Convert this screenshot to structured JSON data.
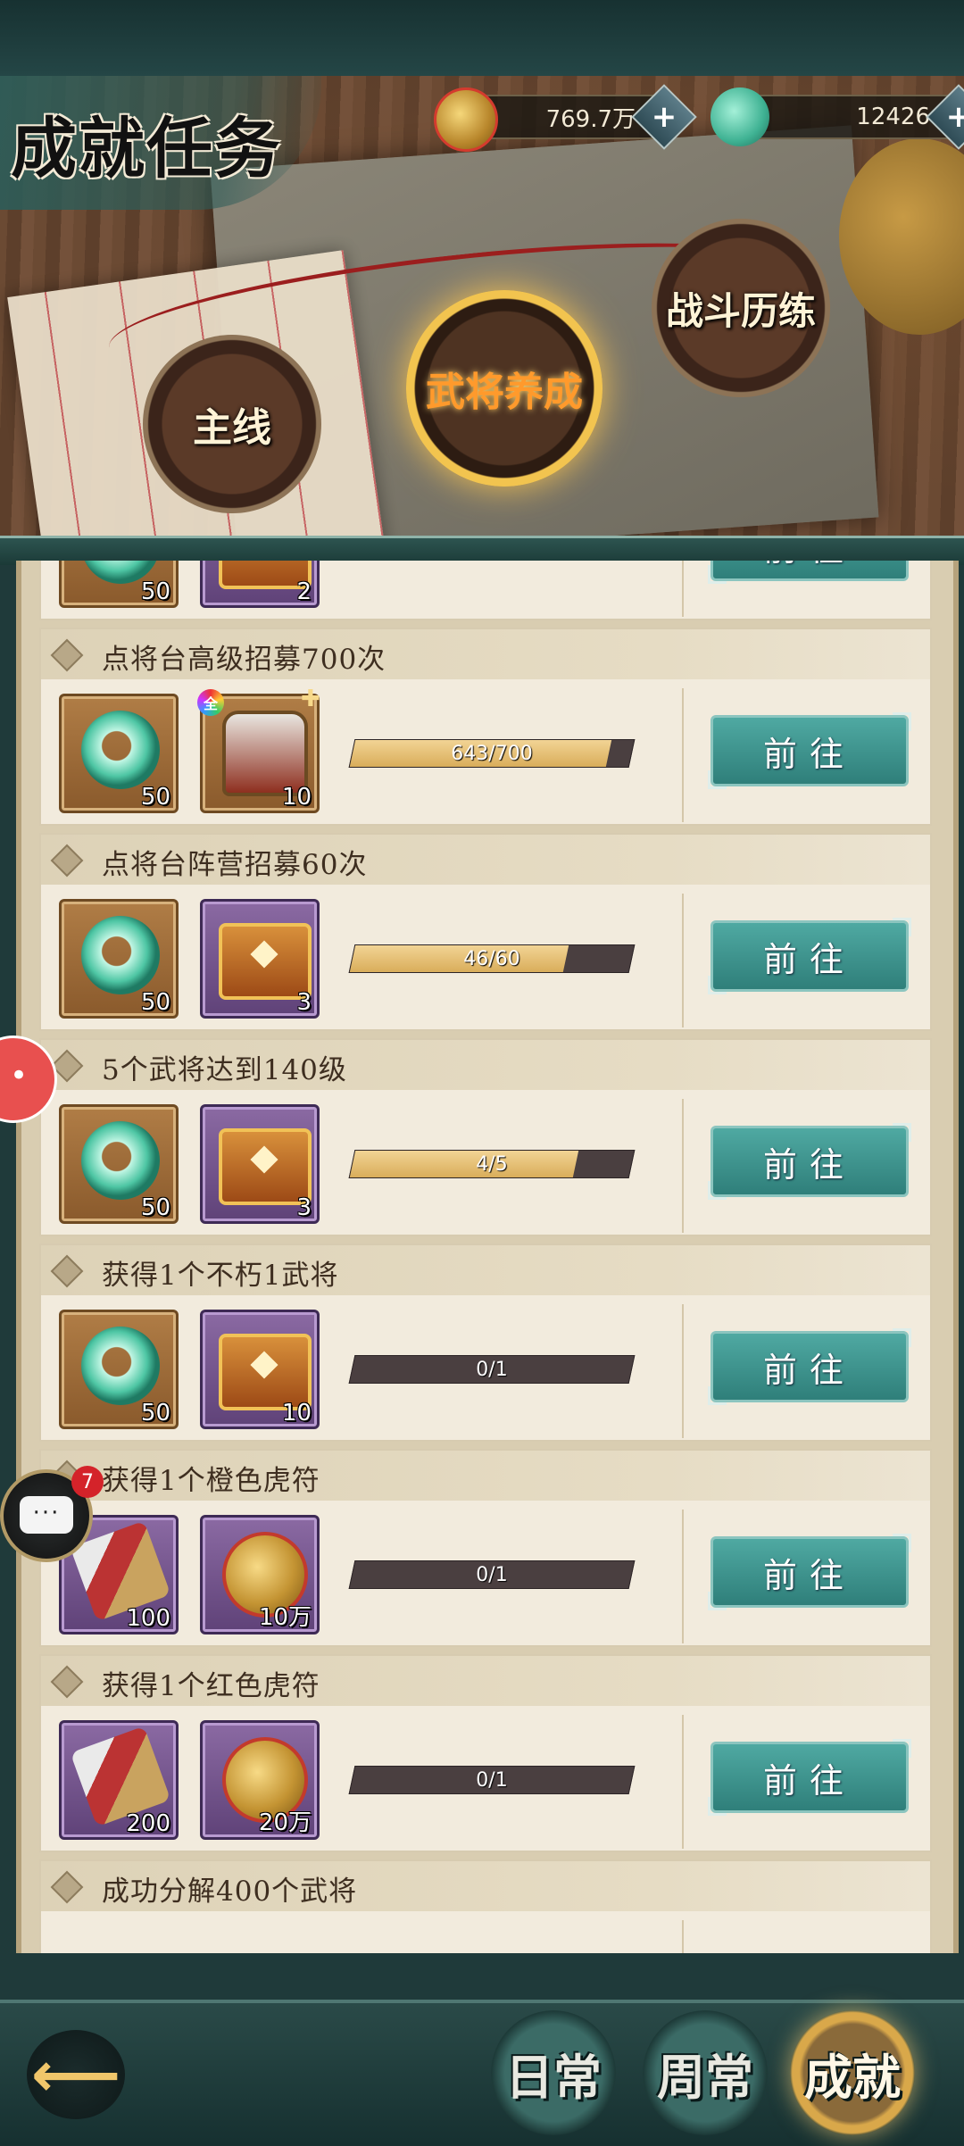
{
  "header": {
    "title": "成就任务",
    "gold_amount": "769.7万",
    "jade_amount": "12426",
    "categories": [
      "主线",
      "武将养成",
      "战斗历练"
    ]
  },
  "tasks": [
    {
      "title": "",
      "rewards": [
        {
          "type": "jade",
          "qty": "50"
        },
        {
          "type": "chest",
          "qty": "2"
        }
      ],
      "progress_text": "",
      "progress": null,
      "button": "前往",
      "partial": true
    },
    {
      "title": "点将台高级招募700次",
      "rewards": [
        {
          "type": "jade",
          "qty": "50"
        },
        {
          "type": "helmet",
          "qty": "10",
          "badge": "全"
        }
      ],
      "progress_text": "643/700",
      "progress": 0.919,
      "button": "前往"
    },
    {
      "title": "点将台阵营招募60次",
      "rewards": [
        {
          "type": "jade",
          "qty": "50"
        },
        {
          "type": "chest",
          "qty": "3"
        }
      ],
      "progress_text": "46/60",
      "progress": 0.767,
      "button": "前往"
    },
    {
      "title": "5个武将达到140级",
      "rewards": [
        {
          "type": "jade",
          "qty": "50"
        },
        {
          "type": "chest",
          "qty": "3"
        }
      ],
      "progress_text": "4/5",
      "progress": 0.8,
      "button": "前往"
    },
    {
      "title": "获得1个不朽1武将",
      "rewards": [
        {
          "type": "jade",
          "qty": "50"
        },
        {
          "type": "chest",
          "qty": "10"
        }
      ],
      "progress_text": "0/1",
      "progress": 0,
      "button": "前往"
    },
    {
      "title": "获得1个橙色虎符",
      "rewards": [
        {
          "type": "tiger",
          "qty": "100"
        },
        {
          "type": "coins",
          "qty": "10万"
        }
      ],
      "progress_text": "0/1",
      "progress": 0,
      "button": "前往"
    },
    {
      "title": "获得1个红色虎符",
      "rewards": [
        {
          "type": "tiger",
          "qty": "200"
        },
        {
          "type": "coins",
          "qty": "20万"
        }
      ],
      "progress_text": "0/1",
      "progress": 0,
      "button": "前往"
    },
    {
      "title": "成功分解400个武将",
      "rewards": [],
      "progress_text": "",
      "progress": null,
      "button": "",
      "partial": true
    }
  ],
  "bottom_tabs": [
    "日常",
    "周常",
    "成就"
  ],
  "chat": {
    "badge_count": "7",
    "icon_text": "···"
  },
  "icons": {
    "gold": "gold-coin-icon",
    "jade": "jade-dragon-icon",
    "plus": "plus-icon",
    "back": "back-arrow-icon",
    "chat": "chat-bubble-icon"
  },
  "colors": {
    "go_button": "#3a8f89",
    "progress_fill": "#e6c073",
    "progress_track": "#4a3f40"
  }
}
